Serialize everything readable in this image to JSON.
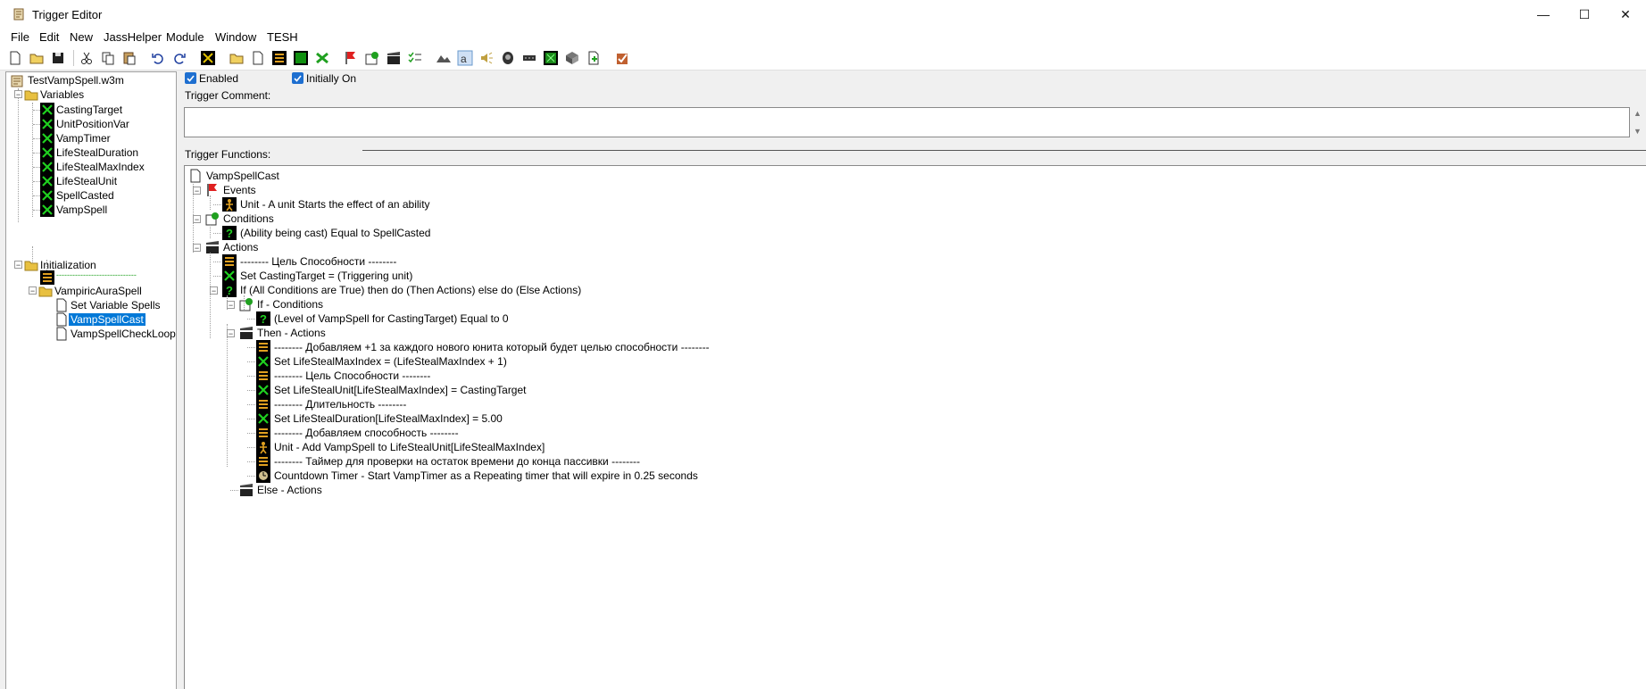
{
  "window": {
    "title": "Trigger Editor",
    "minimize": "—",
    "maximize": "☐",
    "close": "✕"
  },
  "menu": {
    "file": "File",
    "edit": "Edit",
    "new": "New",
    "jasshelper": "JassHelper",
    "module": "Module",
    "window": "Window",
    "tesh": "TESH"
  },
  "tree": {
    "map": "TestVampSpell.w3m",
    "variables_folder": "Variables",
    "variables": [
      "CastingTarget",
      "UnitPositionVar",
      "VampTimer",
      "LifeStealDuration",
      "LifeStealMaxIndex",
      "LifeStealUnit",
      "SpellCasted",
      "VampSpell"
    ],
    "init_folder": "Initialization",
    "separator": "------------------------------",
    "subfolder": "VampiricAuraSpell",
    "triggers": [
      "Set Variable Spells",
      "VampSpellCast",
      "VampSpellCheckLoop"
    ]
  },
  "options": {
    "enabled": "Enabled",
    "initially_on": "Initially On",
    "comment_label": "Trigger Comment:",
    "functions_label": "Trigger Functions:"
  },
  "functions": {
    "root": "VampSpellCast",
    "events": "Events",
    "event1": "Unit - A unit Starts the effect of an ability",
    "conditions": "Conditions",
    "cond1": "(Ability being cast) Equal to SpellCasted",
    "actions": "Actions",
    "a1": "-------- Цель Способности --------",
    "a2": "Set CastingTarget = (Triggering unit)",
    "a3": "If (All Conditions are True) then do (Then Actions) else do (Else Actions)",
    "if_conditions": "If - Conditions",
    "if_cond1": "(Level of VampSpell for CastingTarget) Equal to 0",
    "then_actions": "Then - Actions",
    "t1": "-------- Добавляем +1 за каждого нового юнита который будет целью способности --------",
    "t2": "Set LifeStealMaxIndex = (LifeStealMaxIndex + 1)",
    "t3": "-------- Цель Способности --------",
    "t4": "Set LifeStealUnit[LifeStealMaxIndex] = CastingTarget",
    "t5": "-------- Длительность --------",
    "t6": "Set LifeStealDuration[LifeStealMaxIndex] = 5.00",
    "t7": "-------- Добавляем способность --------",
    "t8": "Unit - Add VampSpell to LifeStealUnit[LifeStealMaxIndex]",
    "t9": "-------- Таймер для проверки на остаток времени до конца пассивки --------",
    "t10": "Countdown Timer - Start VampTimer as a Repeating timer that will expire in 0.25 seconds",
    "else_actions": "Else - Actions"
  },
  "colors": {
    "selection": "#0078d7",
    "var_icon_bg": "#000000",
    "var_icon_fg": "#20d020",
    "folder": "#e8c040",
    "event_flag": "#e02020",
    "comment_icon": "#e0a020"
  },
  "icons": {
    "var": "variable-icon",
    "folder": "folder-icon",
    "trigger": "trigger-document-icon",
    "event": "event-flag-icon",
    "condition": "condition-icon",
    "action": "action-clapper-icon",
    "comment": "comment-icon",
    "unit": "unit-icon",
    "timer": "timer-icon"
  }
}
